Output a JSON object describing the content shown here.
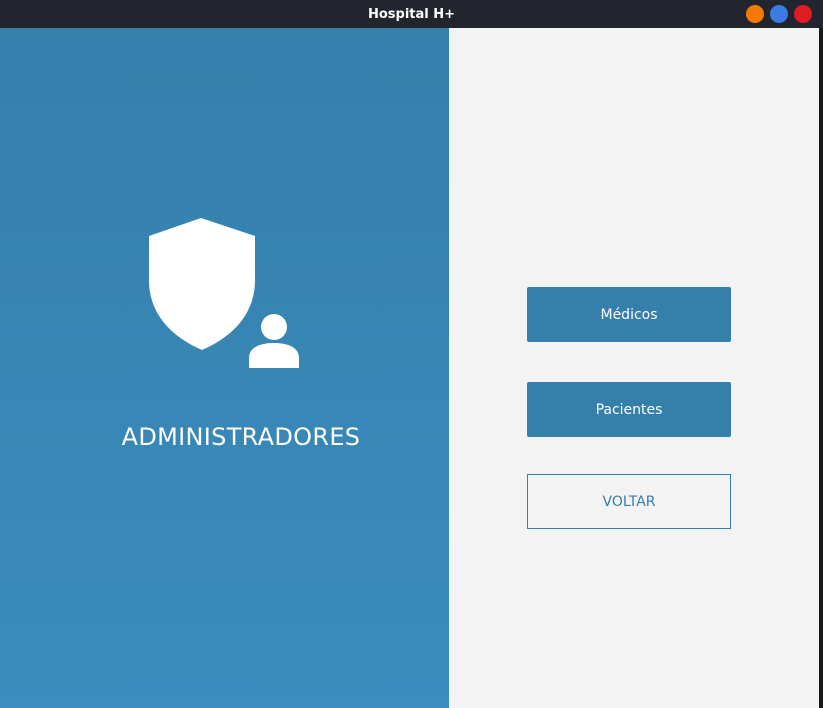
{
  "window": {
    "title": "Hospital H+",
    "controls": [
      {
        "name": "minimize",
        "color": "#f57900"
      },
      {
        "name": "maximize",
        "color": "#3c7ae6"
      },
      {
        "name": "close",
        "color": "#e01b24"
      }
    ]
  },
  "left_panel": {
    "icon": "admin-shield-user-icon",
    "label": "ADMINISTRADORES",
    "colors": {
      "top": "#357fab",
      "bottom": "#3a8dbe"
    }
  },
  "menu": {
    "medicos_label": "Médicos",
    "pacientes_label": "Pacientes",
    "voltar_label": "VOLTAR"
  },
  "colors": {
    "accent": "#357fab",
    "right_background": "#f3f3f3",
    "titlebar": "#23252e"
  }
}
